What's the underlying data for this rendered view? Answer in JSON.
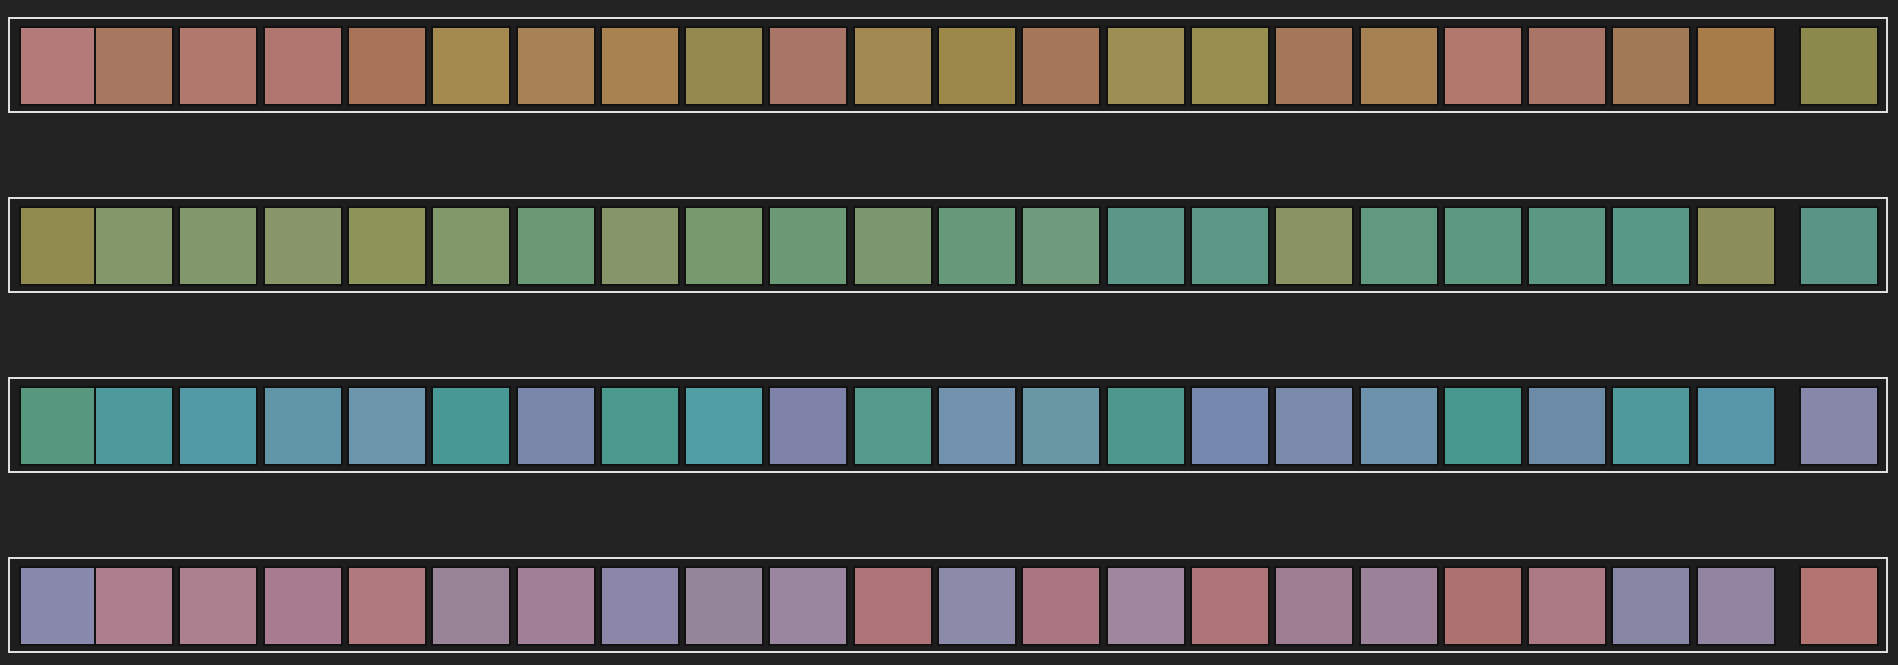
{
  "rows": [
    {
      "start": "#b27b79",
      "end": "#8b8a4c",
      "tiles": [
        "#a87760",
        "#b1796e",
        "#b0766f",
        "#a77359",
        "#a48a4f",
        "#a78257",
        "#a88350",
        "#94894f",
        "#a87566",
        "#a28951",
        "#9c8849",
        "#a67759",
        "#9d8e53",
        "#978e4f",
        "#a47859",
        "#a68152",
        "#b2786e",
        "#a87566",
        "#a37a58",
        "#a77c48"
      ]
    },
    {
      "start": "#908a4e",
      "end": "#599486",
      "tiles": [
        "#84976a",
        "#80986b",
        "#88966a",
        "#8d9459",
        "#80986a",
        "#6b9875",
        "#86966a",
        "#76996d",
        "#6b9875",
        "#7a976f",
        "#66997a",
        "#6f9a7c",
        "#5a9789",
        "#5b9886",
        "#8a9462",
        "#619880",
        "#5d9981",
        "#5a9884",
        "#579886",
        "#8c8e5a"
      ]
    },
    {
      "start": "#57987f",
      "end": "#8687a9",
      "tiles": [
        "#4d999c",
        "#5299a6",
        "#6196a8",
        "#6d96ac",
        "#489995",
        "#7a87ab",
        "#4c998e",
        "#529ea5",
        "#7f82a8",
        "#56998d",
        "#7392ae",
        "#6a97a4",
        "#4d978c",
        "#7688ae",
        "#798aaa",
        "#6d93ac",
        "#48978f",
        "#6c8ba6",
        "#4f999b",
        "#5796a8"
      ]
    },
    {
      "start": "#8889ac",
      "end": "#b37571",
      "tiles": [
        "#ac7e8e",
        "#ad8090",
        "#a87b90",
        "#b07980",
        "#998497",
        "#a28198",
        "#8c87a9",
        "#958799",
        "#9b869f",
        "#ad7376",
        "#8b8ba9",
        "#aa7682",
        "#9e879d",
        "#ad7478",
        "#9e7d93",
        "#9b8298",
        "#ad7170",
        "#aa7984",
        "#8686a4",
        "#9285a2"
      ]
    }
  ]
}
